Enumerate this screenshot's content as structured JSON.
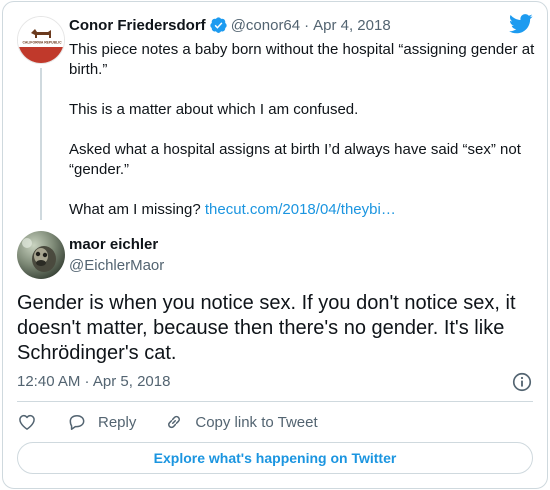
{
  "parent": {
    "name": "Conor Friedersdorf",
    "handle": "@conor64",
    "date_sep": "·",
    "date": "Apr 4, 2018",
    "avatar_text": "CALIFORNIA REPUBLIC",
    "body": [
      "This piece notes a baby born without the hospital “assigning gender at birth.”",
      "This is a matter about which I am confused.",
      "Asked what a hospital assigns at birth I’d always have said “sex” not “gender.”"
    ],
    "last_line_text": "What am I missing? ",
    "link": "thecut.com/2018/04/theybi…"
  },
  "reply": {
    "name": "maor eichler",
    "handle": "@EichlerMaor",
    "text": "Gender is when you notice sex. If you don't notice sex, it doesn't matter, because then there's no gender. It's like Schrödinger's cat.",
    "timestamp": "12:40 AM · Apr 5, 2018"
  },
  "actions": {
    "reply_label": "Reply",
    "copy_label": "Copy link to Tweet"
  },
  "explore_label": "Explore what's happening on Twitter",
  "icons": {
    "brand": "twitter-bird-icon",
    "verified": "verified-badge-icon",
    "info": "info-icon",
    "heart": "heart-icon",
    "reply": "reply-bubble-icon",
    "copy": "link-icon"
  },
  "colors": {
    "twitter_blue": "#1d9bf0",
    "link_blue": "#1b95e0",
    "secondary_text": "#536471",
    "border": "#cfd9de"
  }
}
